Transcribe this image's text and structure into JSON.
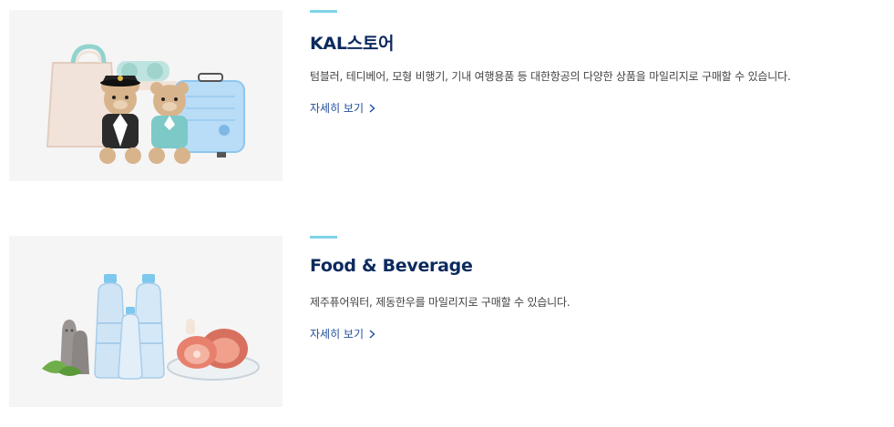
{
  "items": [
    {
      "title": "KAL스토어",
      "description": "텀블러, 테디베어, 모형 비행기, 기내 여행용품 등 대한항공의 다양한 상품을 마일리지로 구매할 수 있습니다.",
      "link_label": "자세히 보기"
    },
    {
      "title": "Food & Beverage",
      "description": "제주퓨어워터, 제동한우를 마일리지로 구매할 수 있습니다.",
      "link_label": "자세히 보기"
    }
  ],
  "icons": {
    "more_arrow": "chevron-right-icon"
  },
  "colors": {
    "title": "#0c2a5e",
    "accent_bar": "#7fd3e8",
    "link": "#1f4e9a",
    "thumb_bg": "#f5f5f5"
  }
}
